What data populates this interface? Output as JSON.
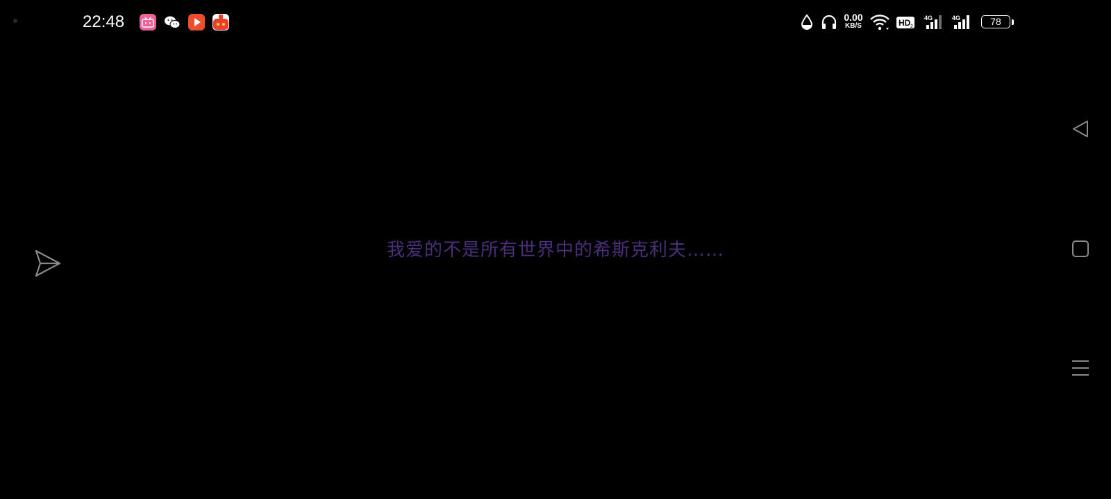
{
  "status_bar": {
    "time": "22:48",
    "notification_icons": [
      "bilibili-icon",
      "wechat-icon",
      "video-app-icon",
      "game-app-icon"
    ],
    "network_speed_value": "0.00",
    "network_speed_unit": "KB/S",
    "hd_badge": "HD",
    "signal_1_label": "4G",
    "signal_2_label": "4G",
    "battery_level": "78"
  },
  "content": {
    "message": "我爱的不是所有世界中的希斯克利夫……"
  },
  "colors": {
    "background": "#000000",
    "message_text": "#4a2e7a",
    "status_text": "#ffffff",
    "nav_icons": "#8a8a8a"
  }
}
